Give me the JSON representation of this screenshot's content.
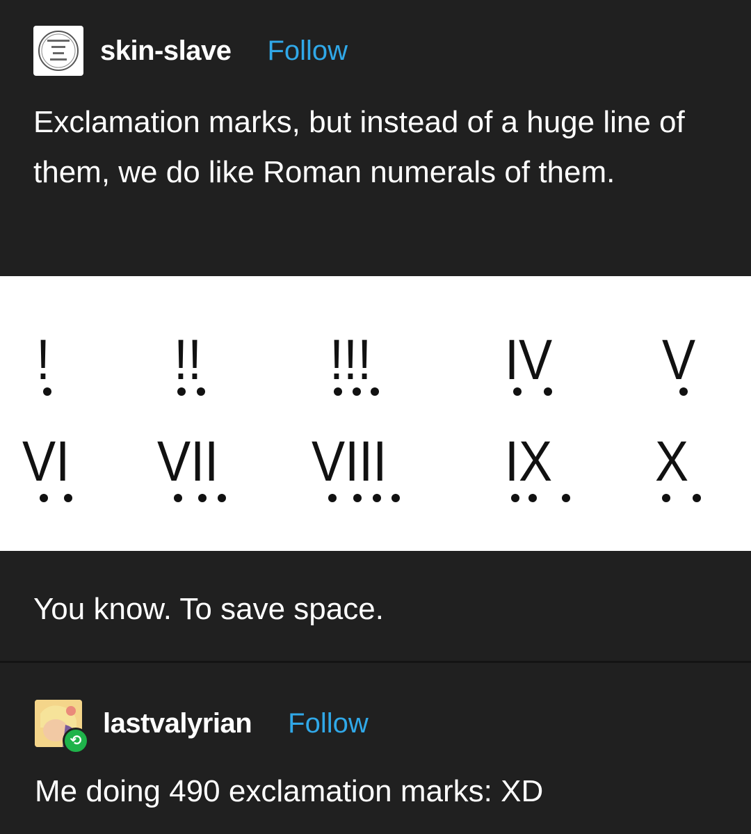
{
  "post": {
    "username": "skin-slave",
    "follow_label": "Follow",
    "avatar_icon": "coin-seal-icon",
    "text": "Exclamation marks, but instead of a huge line of them, we do like Roman numerals of them.",
    "caption": "You know. To save space."
  },
  "image": {
    "numerals": [
      {
        "glyph": "!",
        "dots": 1
      },
      {
        "glyph": "!!",
        "dots": 2
      },
      {
        "glyph": "!!!",
        "dots": 3
      },
      {
        "glyph": "IV",
        "dots": 2
      },
      {
        "glyph": "V",
        "dots": 1
      },
      {
        "glyph": "VI",
        "dots": 2
      },
      {
        "glyph": "VII",
        "dots": 3
      },
      {
        "glyph": "VIII",
        "dots": 4
      },
      {
        "glyph": "IX",
        "dots": 3
      },
      {
        "glyph": "X",
        "dots": 2
      }
    ]
  },
  "reply": {
    "username": "lastvalyrian",
    "follow_label": "Follow",
    "badge_icon": "reblog-icon",
    "text": "Me doing 490 exclamation marks: XD"
  },
  "colors": {
    "background": "#202020",
    "follow": "#30a8e8",
    "reblog_badge": "#1fb34a"
  }
}
